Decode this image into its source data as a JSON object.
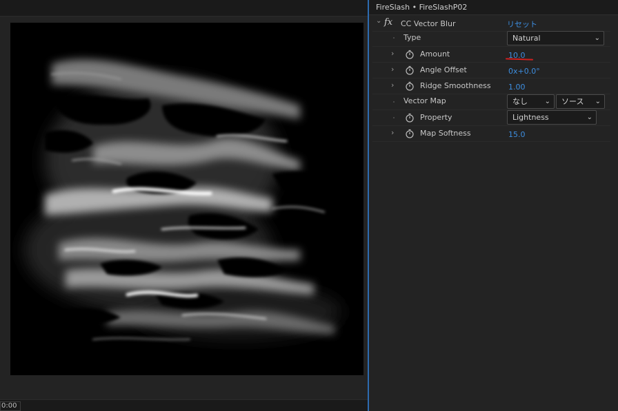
{
  "viewer": {
    "timecode": "0:00"
  },
  "panel": {
    "title": "FireSlash • FireSlashP02",
    "effect": {
      "fx_symbol": "fx",
      "name": "CC Vector Blur",
      "reset_label": "リセット"
    },
    "params": {
      "type": {
        "label": "Type",
        "value": "Natural"
      },
      "amount": {
        "label": "Amount",
        "value": "10.0"
      },
      "angle_offset": {
        "label": "Angle Offset",
        "value": "0x+0.0°"
      },
      "ridge_smoothness": {
        "label": "Ridge Smoothness",
        "value": "1.00"
      },
      "vector_map": {
        "label": "Vector Map",
        "layer_value": "なし",
        "source_value": "ソース"
      },
      "property": {
        "label": "Property",
        "value": "Lightness"
      },
      "map_softness": {
        "label": "Map Softness",
        "value": "15.0"
      }
    },
    "colors": {
      "value_blue": "#3d8ee0",
      "annotation_red": "#d12020",
      "panel_divider_blue": "#2d6bb0"
    }
  }
}
